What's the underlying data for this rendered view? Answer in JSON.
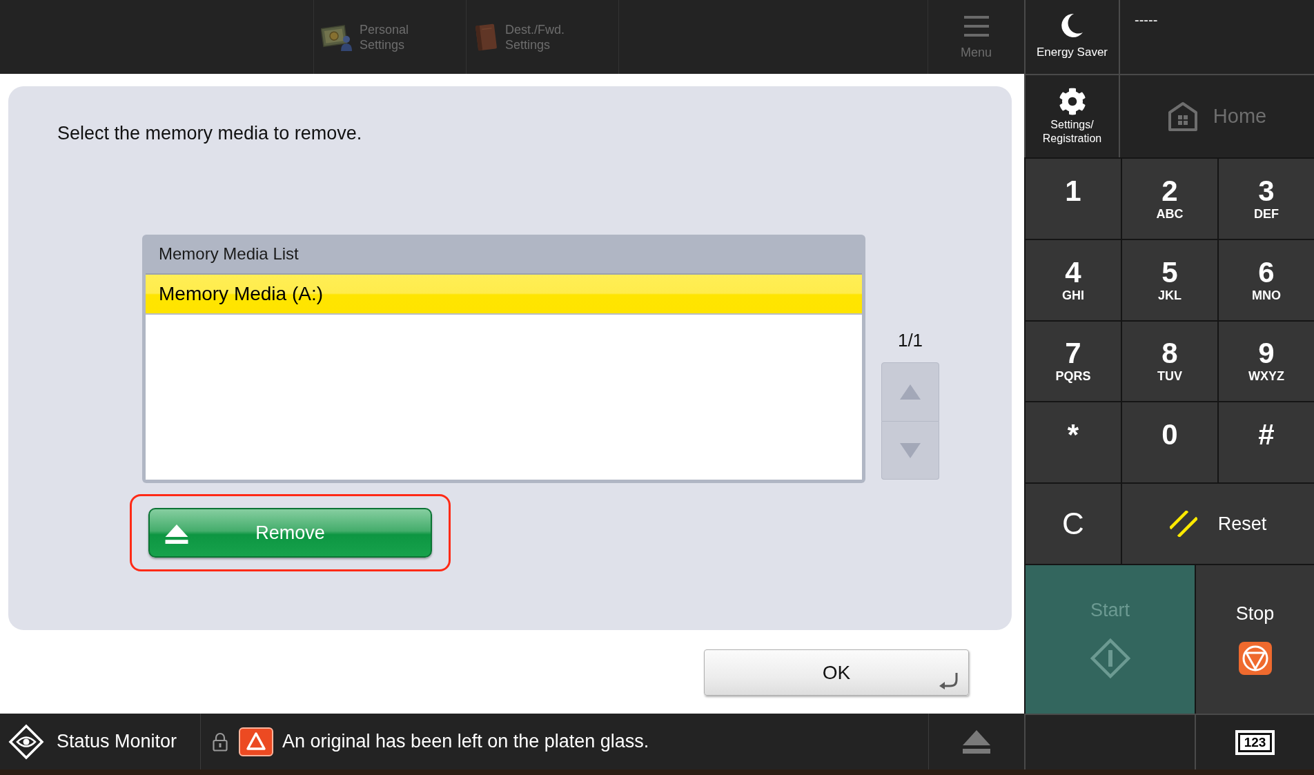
{
  "top_bar": {
    "shortcuts": [
      {
        "kind": "personal",
        "label": "Personal Settings",
        "disabled": true
      },
      {
        "kind": "address",
        "label": "Dest./Fwd. Settings",
        "disabled": true
      }
    ],
    "menu": {
      "label": "Menu",
      "disabled": true
    }
  },
  "side_panel": {
    "energy_saver": {
      "label": "Energy Saver"
    },
    "display": "-----",
    "settings": {
      "label": "Settings/Registration"
    },
    "home": {
      "label": "Home",
      "disabled": true
    }
  },
  "dialog": {
    "message": "Select the memory media to remove.",
    "list": {
      "title": "Memory Media List",
      "items": [
        {
          "label": "Memory Media (A:)",
          "selected": true
        }
      ]
    },
    "page_indicator": "1/1",
    "scroll_up": {
      "disabled": true
    },
    "scroll_down": {
      "disabled": true
    },
    "remove_button": {
      "label": "Remove",
      "highlighted": true
    }
  },
  "ok_button": {
    "label": "OK"
  },
  "keypad": {
    "keys": [
      {
        "digit": "1"
      },
      {
        "digit": "2",
        "letters": "ABC"
      },
      {
        "digit": "3",
        "letters": "DEF"
      },
      {
        "digit": "4",
        "letters": "GHI"
      },
      {
        "digit": "5",
        "letters": "JKL"
      },
      {
        "digit": "6",
        "letters": "MNO"
      },
      {
        "digit": "7",
        "letters": "PQRS"
      },
      {
        "digit": "8",
        "letters": "TUV"
      },
      {
        "digit": "9",
        "letters": "WXYZ"
      },
      {
        "digit": "*"
      },
      {
        "digit": "0"
      },
      {
        "digit": "#"
      }
    ],
    "clear": {
      "label": "C"
    },
    "reset": {
      "label": "Reset"
    },
    "start": {
      "label": "Start",
      "disabled": true
    },
    "stop": {
      "label": "Stop"
    }
  },
  "status_bar": {
    "status_monitor": {
      "label": "Status Monitor"
    },
    "message": "An original has been left on the platen glass.",
    "eject_button": {
      "disabled": true
    },
    "numeric_keys_button": {
      "label": "123"
    }
  }
}
